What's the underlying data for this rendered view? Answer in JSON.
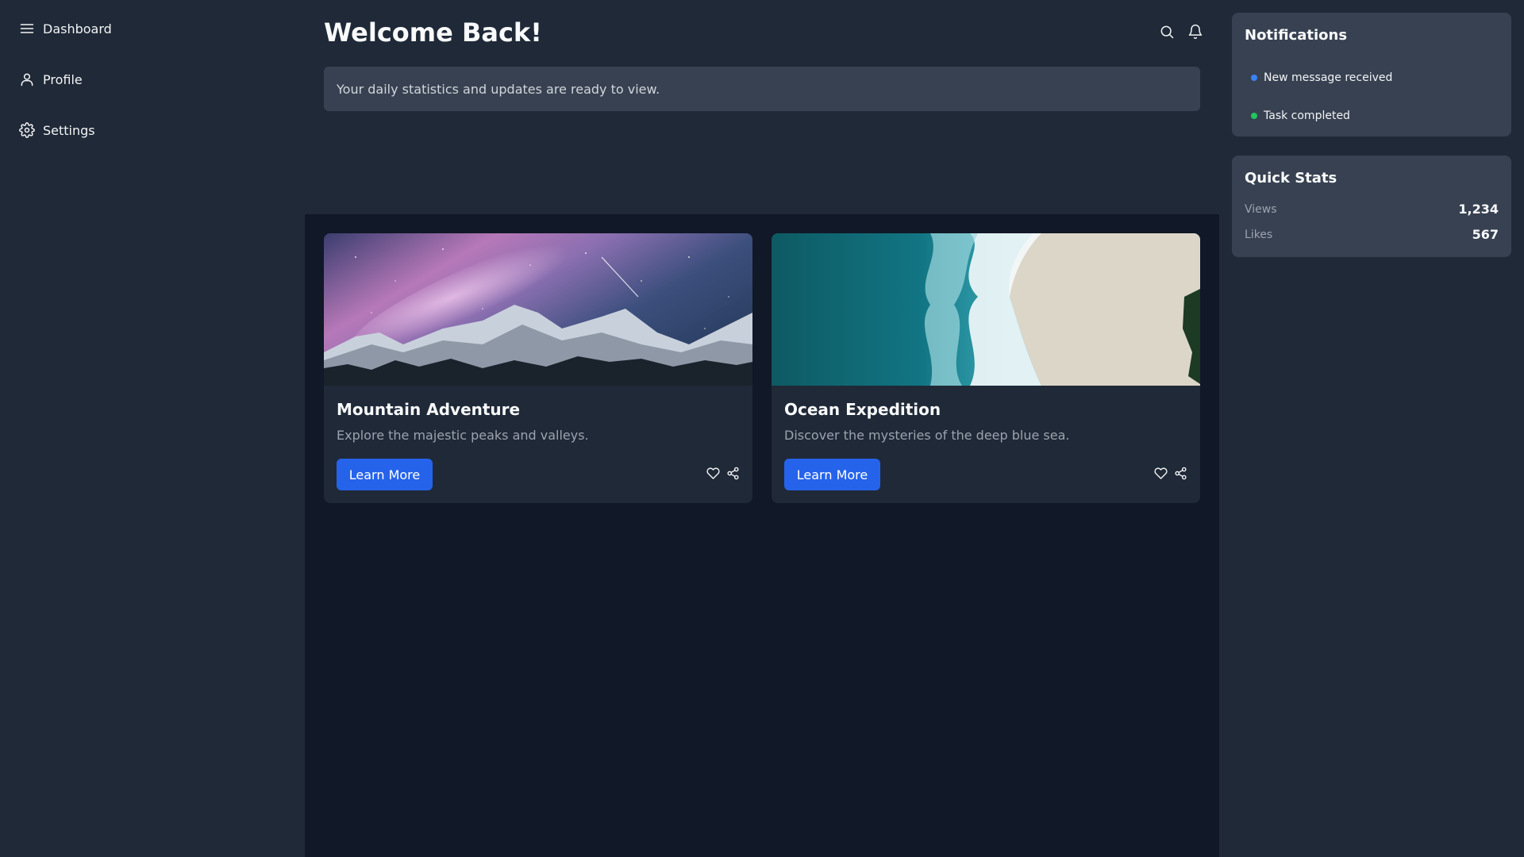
{
  "sidebar": {
    "items": [
      {
        "label": "Dashboard",
        "icon": "menu-icon"
      },
      {
        "label": "Profile",
        "icon": "user-icon"
      },
      {
        "label": "Settings",
        "icon": "gear-icon"
      }
    ]
  },
  "header": {
    "title": "Welcome Back!",
    "banner": "Your daily statistics and updates are ready to view.",
    "icons": [
      "search-icon",
      "bell-icon"
    ]
  },
  "cards": [
    {
      "title": "Mountain Adventure",
      "description": "Explore the majestic peaks and valleys.",
      "button_label": "Learn More",
      "image": "snowy mountains under the milky way"
    },
    {
      "title": "Ocean Expedition",
      "description": "Discover the mysteries of the deep blue sea.",
      "button_label": "Learn More",
      "image": "aerial view of ocean waves on a sandy beach"
    }
  ],
  "notifications": {
    "title": "Notifications",
    "items": [
      {
        "text": "New message received",
        "color": "#3b82f6"
      },
      {
        "text": "Task completed",
        "color": "#22c55e"
      }
    ]
  },
  "quick_stats": {
    "title": "Quick Stats",
    "rows": [
      {
        "label": "Views",
        "value": "1,234"
      },
      {
        "label": "Likes",
        "value": "567"
      }
    ]
  },
  "colors": {
    "background": "#1f2937",
    "content_background": "#111827",
    "panel": "#374151",
    "accent": "#2563eb"
  }
}
